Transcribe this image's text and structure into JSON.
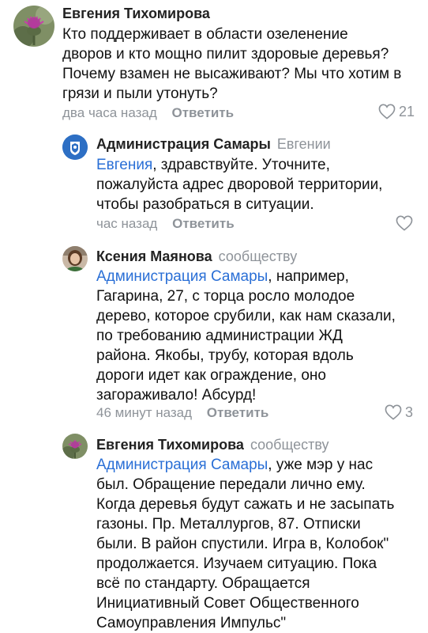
{
  "comments": [
    {
      "author": "Евгения Тихомирова",
      "lines": [
        "Кто поддерживает в области озеленение",
        "дворов и кто мощно пилит здоровые деревья?",
        "Почему взамен не высаживают? Мы что хотим в",
        "грязи и пыли утонуть?"
      ],
      "time": "два часа назад",
      "reply_label": "Ответить",
      "likes": "21"
    },
    {
      "author": "Администрация Самары",
      "reply_to": "Евгении",
      "mention": "Евгения",
      "lines": [
        ", здравствуйте. Уточните,",
        "пожалуйста адрес дворовой территории,",
        "чтобы разобраться в ситуации."
      ],
      "time": "час назад",
      "reply_label": "Ответить",
      "likes": ""
    },
    {
      "author": "Ксения Маянова",
      "reply_to": "сообществу",
      "mention": "Администрация Самары",
      "lines": [
        ", например,",
        "Гагарина, 27, с торца росло молодое",
        "дерево, которое срубили, как нам сказали,",
        "по требованию администрации ЖД",
        "района. Якобы, трубу, которая вдоль",
        "дороги идет как ограждение, оно",
        "загораживало! Абсурд!"
      ],
      "time": "46 минут назад",
      "reply_label": "Ответить",
      "likes": "3"
    },
    {
      "author": "Евгения Тихомирова",
      "reply_to": "сообществу",
      "mention": "Администрация Самары",
      "lines": [
        ", уже мэр у нас",
        "был. Обращение передали лично ему.",
        "Когда деревья будут сажать и не засыпать",
        "газоны. Пр. Металлургов, 87. Отписки",
        "были. В район спустили. Игра в, Колобок\"",
        "продолжается. Изучаем ситуацию. Пока",
        "всё по стандарту. Обращается",
        "Инициативный Совет Общественного",
        "Самоуправления Импульс\""
      ]
    }
  ],
  "colors": {
    "link": "#2a6fd6",
    "muted": "#8e9399",
    "admin_blue": "#2d6fc4"
  }
}
